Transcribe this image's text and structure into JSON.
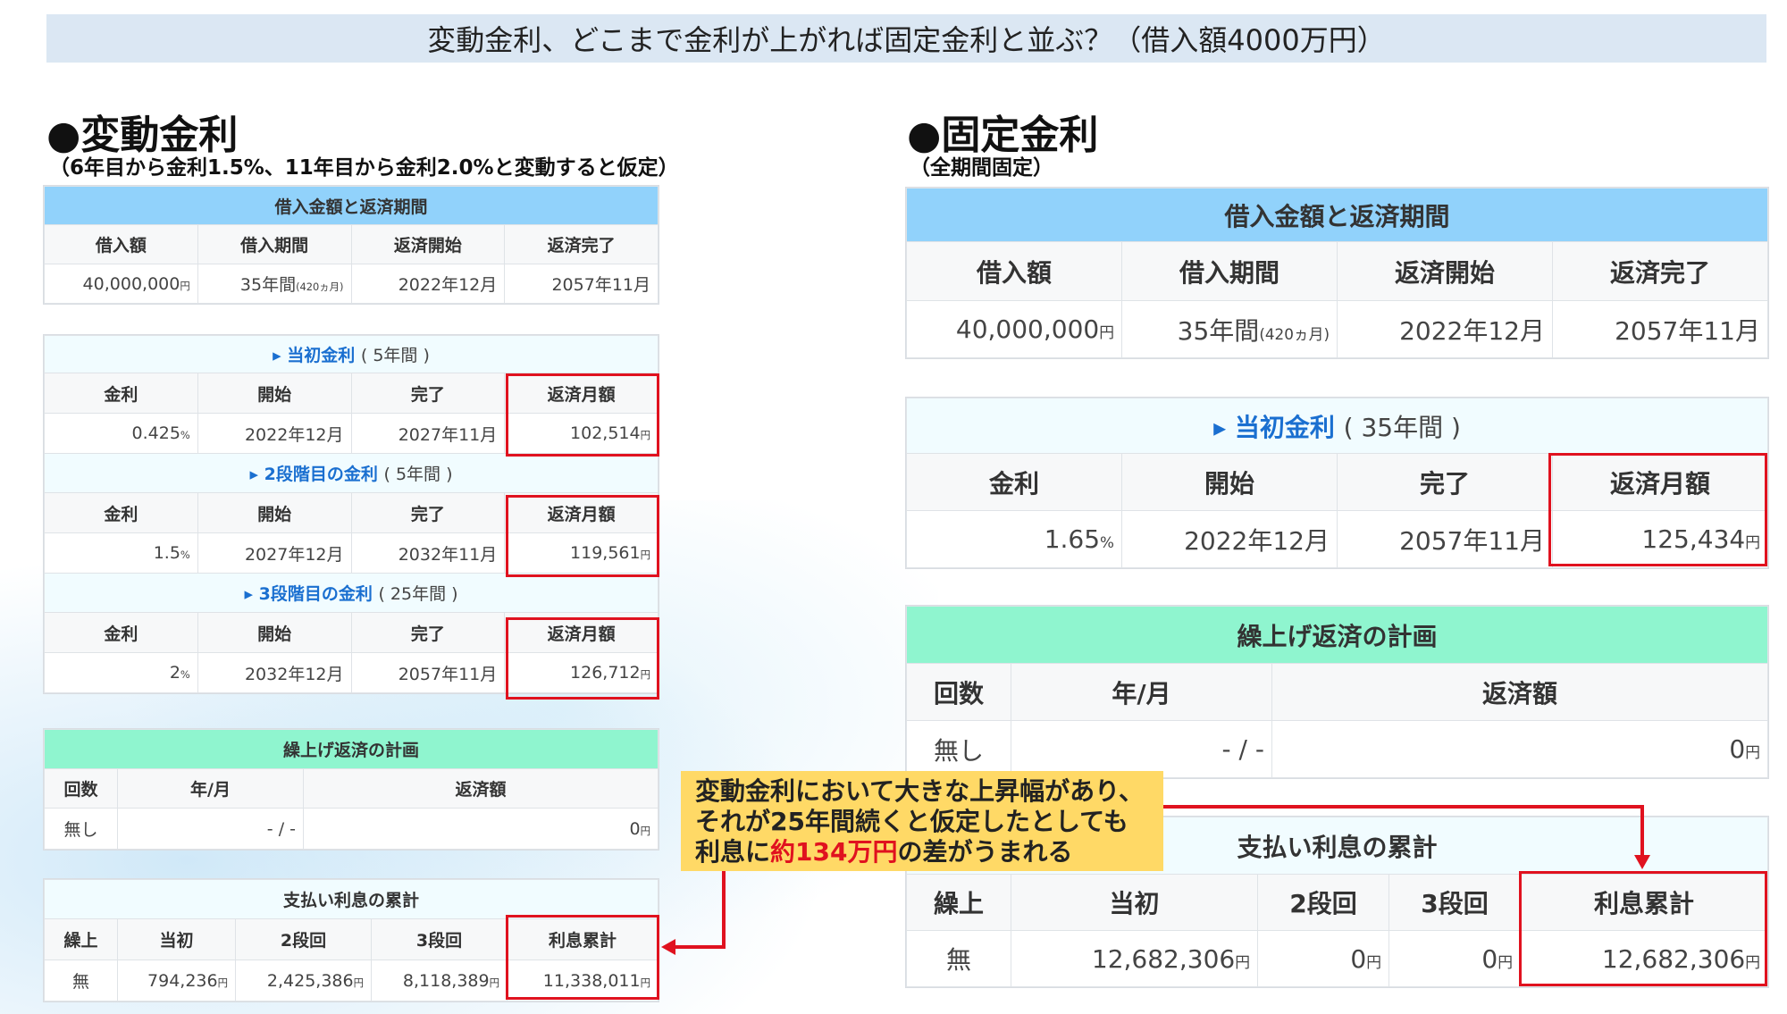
{
  "banner": "変動金利、どこまで金利が上がれば固定金利と並ぶ？（借入額4000万円）",
  "left": {
    "title": "●変動金利",
    "subtitle": "（6年目から金利1.5%、11年目から金利2.0%と変動すると仮定）",
    "loan": {
      "header": "借入金額と返済期間",
      "cols": [
        "借入額",
        "借入期間",
        "返済開始",
        "返済完了"
      ],
      "amount": "40,000,000",
      "amount_unit": "円",
      "period": "35年間",
      "period_note": "(420ヵ月)",
      "start": "2022年12月",
      "end": "2057年11月"
    },
    "stages": [
      {
        "title": "当初金利",
        "note": "( 5年間 )",
        "cols": [
          "金利",
          "開始",
          "完了",
          "返済月額"
        ],
        "rate": "0.425",
        "rate_unit": "%",
        "start": "2022年12月",
        "end": "2027年11月",
        "monthly": "102,514",
        "monthly_unit": "円"
      },
      {
        "title": "2段階目の金利",
        "note": "( 5年間 )",
        "cols": [
          "金利",
          "開始",
          "完了",
          "返済月額"
        ],
        "rate": "1.5",
        "rate_unit": "%",
        "start": "2027年12月",
        "end": "2032年11月",
        "monthly": "119,561",
        "monthly_unit": "円"
      },
      {
        "title": "3段階目の金利",
        "note": "( 25年間 )",
        "cols": [
          "金利",
          "開始",
          "完了",
          "返済月額"
        ],
        "rate": "2",
        "rate_unit": "%",
        "start": "2032年12月",
        "end": "2057年11月",
        "monthly": "126,712",
        "monthly_unit": "円"
      }
    ],
    "prepay": {
      "header": "繰上げ返済の計画",
      "cols": [
        "回数",
        "年/月",
        "返済額"
      ],
      "count": "無し",
      "ym": "- / -",
      "amount": "0",
      "amount_unit": "円"
    },
    "interest": {
      "header": "支払い利息の累計",
      "cols": [
        "繰上",
        "当初",
        "2段回",
        "3段回",
        "利息累計"
      ],
      "prepay": "無",
      "initial": "794,236",
      "second": "2,425,386",
      "third": "8,118,389",
      "total": "11,338,011",
      "unit": "円"
    }
  },
  "right": {
    "title": "●固定金利",
    "subtitle": "（全期間固定）",
    "loan": {
      "header": "借入金額と返済期間",
      "cols": [
        "借入額",
        "借入期間",
        "返済開始",
        "返済完了"
      ],
      "amount": "40,000,000",
      "amount_unit": "円",
      "period": "35年間",
      "period_note": "(420ヵ月)",
      "start": "2022年12月",
      "end": "2057年11月"
    },
    "stage": {
      "title": "当初金利",
      "note": "( 35年間 )",
      "cols": [
        "金利",
        "開始",
        "完了",
        "返済月額"
      ],
      "rate": "1.65",
      "rate_unit": "%",
      "start": "2022年12月",
      "end": "2057年11月",
      "monthly": "125,434",
      "monthly_unit": "円"
    },
    "prepay": {
      "header": "繰上げ返済の計画",
      "cols": [
        "回数",
        "年/月",
        "返済額"
      ],
      "count": "無し",
      "ym": "- / -",
      "amount": "0",
      "amount_unit": "円"
    },
    "interest": {
      "header": "支払い利息の累計",
      "cols": [
        "繰上",
        "当初",
        "2段回",
        "3段回",
        "利息累計"
      ],
      "prepay": "無",
      "initial": "12,682,306",
      "second": "0",
      "third": "0",
      "total": "12,682,306",
      "unit": "円"
    }
  },
  "callout": {
    "line1": "変動金利において大きな上昇幅があり、",
    "line2": "それが25年間続くと仮定したとしても",
    "line3_a": "利息に",
    "line3_em": "約134万円",
    "line3_b": "の差がうまれる"
  },
  "colors": {
    "accent_red": "#e0121f",
    "head_blue": "#91d2fb",
    "head_mint": "#8ff5cf",
    "callout_yellow": "#ffd966",
    "banner": "#dbe7f3"
  }
}
